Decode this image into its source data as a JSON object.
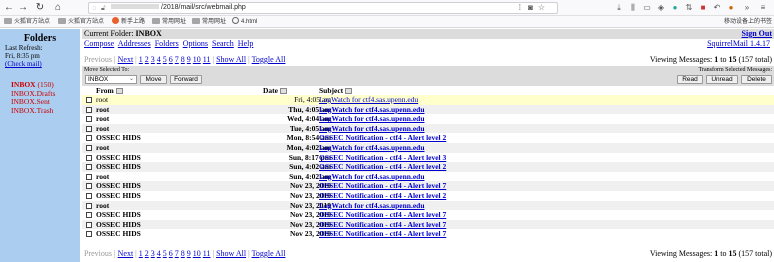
{
  "browser": {
    "url": "/2018/mail/src/webmail.php",
    "bookmarks": [
      "火狐官方站点",
      "火狐官方站点",
      "新手上路",
      "常用网址",
      "常用网址",
      "4.html"
    ],
    "mobile_bookmarks": "移动设备上的书签"
  },
  "sidebar": {
    "title": "Folders",
    "last_refresh_label": "Last Refresh:",
    "last_refresh_time": "Fri, 8:35 pm",
    "check_mail": "(Check mail)",
    "folders": [
      {
        "name": "INBOX",
        "count": "(150)"
      },
      {
        "name": "INBOX.Drafts"
      },
      {
        "name": "INBOX.Sent"
      },
      {
        "name": "INBOX.Trash"
      }
    ]
  },
  "header": {
    "current_folder_label": "Current Folder:",
    "current_folder": "INBOX",
    "sign_out": "Sign Out",
    "nav": [
      "Compose",
      "Addresses",
      "Folders",
      "Options",
      "Search",
      "Help"
    ],
    "version": "SquirrelMail 1.4.17"
  },
  "pager": {
    "previous": "Previous",
    "next": "Next",
    "pages": [
      "1",
      "2",
      "3",
      "4",
      "5",
      "6",
      "7",
      "8",
      "9",
      "10",
      "11"
    ],
    "show_all": "Show All",
    "toggle_all": "Toggle All",
    "viewing_prefix": "Viewing Messages:",
    "from": "1",
    "to_label": "to",
    "to": "15",
    "total": "(157 total)"
  },
  "move": {
    "selected_to_label": "Move Selected To:",
    "transform_label": "Transform Selected Messages:",
    "folder": "INBOX",
    "move_button": "Move",
    "forward_button": "Forward",
    "read_button": "Read",
    "unread_button": "Unread",
    "delete_button": "Delete"
  },
  "columns": {
    "from": "From",
    "date": "Date",
    "subject": "Subject"
  },
  "messages": [
    {
      "from": "root",
      "date": "Fri, 4:05 am",
      "subject": "LogWatch for ctf4.sas.upenn.edu",
      "unread": false
    },
    {
      "from": "root",
      "date": "Thu, 4:05 am",
      "subject": "LogWatch for ctf4.sas.upenn.edu",
      "unread": true
    },
    {
      "from": "root",
      "date": "Wed, 4:04 am",
      "subject": "LogWatch for ctf4.sas.upenn.edu",
      "unread": true
    },
    {
      "from": "root",
      "date": "Tue, 4:05 am",
      "subject": "LogWatch for ctf4.sas.upenn.edu",
      "unread": true
    },
    {
      "from": "OSSEC HIDS",
      "date": "Mon, 8:54 am",
      "subject": "OSSEC Notification - ctf4 - Alert level 2",
      "unread": true
    },
    {
      "from": "root",
      "date": "Mon, 4:02 am",
      "subject": "LogWatch for ctf4.sas.upenn.edu",
      "unread": true
    },
    {
      "from": "OSSEC HIDS",
      "date": "Sun, 8:17 pm",
      "subject": "OSSEC Notification - ctf4 - Alert level 3",
      "unread": true
    },
    {
      "from": "OSSEC HIDS",
      "date": "Sun, 4:02 am",
      "subject": "OSSEC Notification - ctf4 - Alert level 2",
      "unread": true
    },
    {
      "from": "root",
      "date": "Sun, 4:02 am",
      "subject": "LogWatch for ctf4.sas.upenn.edu",
      "unread": true
    },
    {
      "from": "OSSEC HIDS",
      "date": "Nov 23, 2019",
      "subject": "OSSEC Notification - ctf4 - Alert level 7",
      "unread": true
    },
    {
      "from": "OSSEC HIDS",
      "date": "Nov 23, 2019",
      "subject": "OSSEC Notification - ctf4 - Alert level 2",
      "unread": true
    },
    {
      "from": "root",
      "date": "Nov 23, 2019",
      "subject": "LogWatch for ctf4.sas.upenn.edu",
      "unread": true
    },
    {
      "from": "OSSEC HIDS",
      "date": "Nov 23, 2019",
      "subject": "OSSEC Notification - ctf4 - Alert level 7",
      "unread": true
    },
    {
      "from": "OSSEC HIDS",
      "date": "Nov 23, 2019",
      "subject": "OSSEC Notification - ctf4 - Alert level 7",
      "unread": true
    },
    {
      "from": "OSSEC HIDS",
      "date": "Nov 23, 2019",
      "subject": "OSSEC Notification - ctf4 - Alert level 7",
      "unread": true
    }
  ]
}
